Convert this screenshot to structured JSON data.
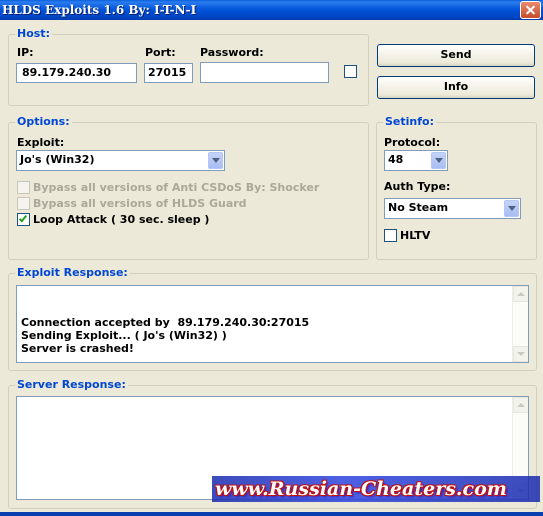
{
  "window": {
    "title": "HLDS Exploits 1.6 By: I-T-N-I",
    "close_label": ""
  },
  "host": {
    "legend": "Host:",
    "ip_label": "IP:",
    "ip_value": "89.179.240.30",
    "port_label": "Port:",
    "port_value": "27015",
    "password_label": "Password:",
    "password_value": "",
    "password_toggle_checked": false
  },
  "actions": {
    "send_label": "Send",
    "info_label": "Info"
  },
  "options": {
    "legend": "Options:",
    "exploit_label": "Exploit:",
    "exploit_value": "Jo's (Win32)",
    "bypass_csdos_label": "Bypass all versions of Anti CSDoS By: Shocker",
    "bypass_csdos_checked": false,
    "bypass_guard_label": "Bypass all versions of HLDS Guard",
    "bypass_guard_checked": false,
    "loop_attack_label": "Loop Attack ( 30 sec. sleep )",
    "loop_attack_checked": true
  },
  "setinfo": {
    "legend": "Setinfo:",
    "protocol_label": "Protocol:",
    "protocol_value": "48",
    "auth_label": "Auth Type:",
    "auth_value": "No Steam",
    "hltv_label": "HLTV",
    "hltv_checked": false
  },
  "exploit_response": {
    "legend": "Exploit Response:",
    "text": "Connection accepted by  89.179.240.30:27015\nSending Exploit... ( Jo's (Win32) )\nServer is crashed!"
  },
  "server_response": {
    "legend": "Server Response:",
    "text": ""
  },
  "watermark": {
    "text": "www.Russian-Cheaters.com"
  },
  "colors": {
    "titlebar": "#0052d6",
    "legend": "#0046d5",
    "window_bg": "#ece9d8"
  }
}
